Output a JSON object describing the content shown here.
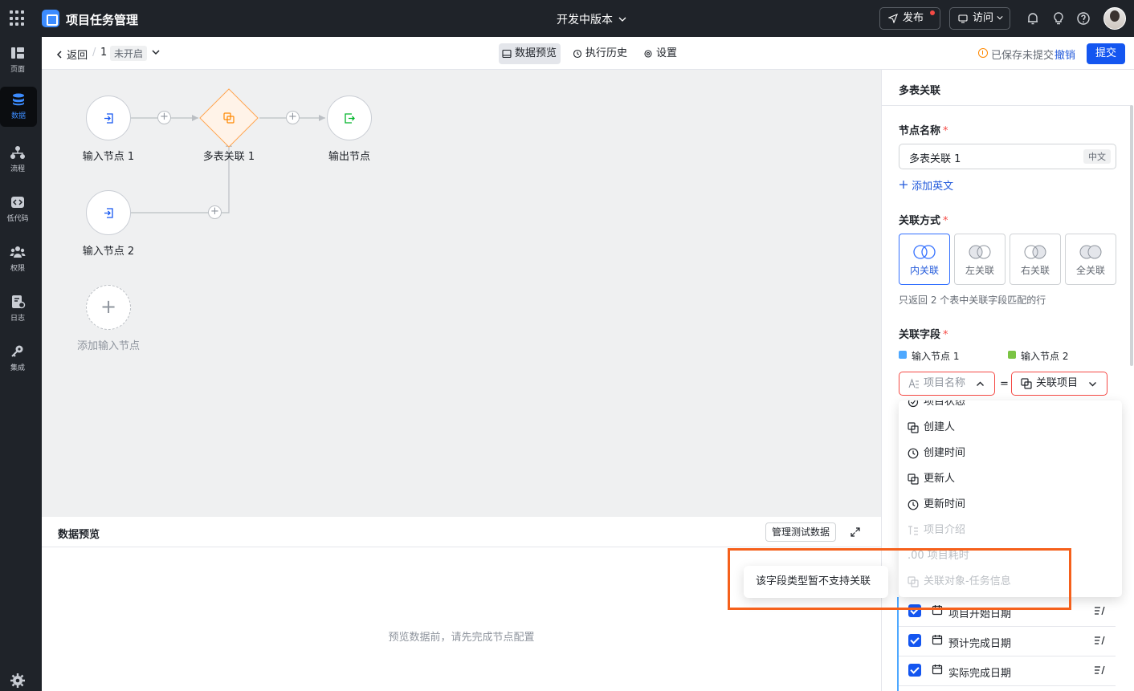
{
  "app": {
    "name": "项目任务管理",
    "version_label": "开发中版本"
  },
  "topbar": {
    "publish_label": "发布",
    "visit_label": "访问"
  },
  "sidebar": {
    "items": [
      {
        "label": "页面",
        "icon": "page-icon",
        "active": false
      },
      {
        "label": "数据",
        "icon": "database-icon",
        "active": true
      },
      {
        "label": "流程",
        "icon": "flow-icon",
        "active": false
      },
      {
        "label": "低代码",
        "icon": "code-icon",
        "active": false
      },
      {
        "label": "权限",
        "icon": "users-icon",
        "active": false
      },
      {
        "label": "日志",
        "icon": "log-icon",
        "active": false
      },
      {
        "label": "集成",
        "icon": "key-icon",
        "active": false
      }
    ]
  },
  "subbar": {
    "back_label": "返回",
    "separator": "/",
    "crumb_number": "1",
    "status": "未开启",
    "tabs": [
      {
        "label": "数据预览",
        "icon": "preview-icon",
        "active": true
      },
      {
        "label": "执行历史",
        "icon": "history-icon",
        "active": false
      },
      {
        "label": "设置",
        "icon": "gear-icon",
        "active": false
      }
    ],
    "unsaved_label": "已保存未提交",
    "undo_label": "撤销",
    "submit_label": "提交"
  },
  "canvas": {
    "nodes": {
      "input1": "输入节点 1",
      "join1": "多表关联 1",
      "output": "输出节点",
      "input2": "输入节点 2",
      "add_input": "添加输入节点"
    }
  },
  "preview": {
    "title": "数据预览",
    "manage_label": "管理测试数据",
    "empty_text": "预览数据前，请先完成节点配置"
  },
  "panel": {
    "title": "多表关联",
    "node_name_label": "节点名称",
    "required_mark": "*",
    "node_name_value": "多表关联 1",
    "lang_tag": "中文",
    "add_english": "添加英文",
    "join_type_label": "关联方式",
    "join_types": [
      "内关联",
      "左关联",
      "右关联",
      "全关联"
    ],
    "join_selected": "内关联",
    "join_hint": "只返回 2 个表中关联字段匹配的行",
    "join_field_label": "关联字段",
    "source1": "输入节点 1",
    "source2": "输入节点 2",
    "left_field_placeholder": "项目名称",
    "equals": "=",
    "right_field": "关联项目",
    "dropdown": [
      {
        "label": "项目状态",
        "icon": "status-icon",
        "disabled": false
      },
      {
        "label": "创建人",
        "icon": "link-icon",
        "disabled": false
      },
      {
        "label": "创建时间",
        "icon": "clock-icon",
        "disabled": false
      },
      {
        "label": "更新人",
        "icon": "link-icon",
        "disabled": false
      },
      {
        "label": "更新时间",
        "icon": "clock-icon",
        "disabled": false
      },
      {
        "label": "项目介绍",
        "icon": "text-icon",
        "disabled": true
      },
      {
        "label": ".00 项目耗时",
        "icon": "number-icon",
        "disabled": true
      },
      {
        "label": "关联对象-任务信息",
        "icon": "link-icon",
        "disabled": true
      }
    ],
    "output_fields": [
      {
        "label": "项目开始日期",
        "checked": true
      },
      {
        "label": "预计完成日期",
        "checked": true
      },
      {
        "label": "实际完成日期",
        "checked": true
      }
    ]
  },
  "tooltip": {
    "text": "该字段类型暂不支持关联"
  },
  "colors": {
    "accent": "#1456f0",
    "highlight": "#f5601b",
    "error": "#f54a45"
  }
}
